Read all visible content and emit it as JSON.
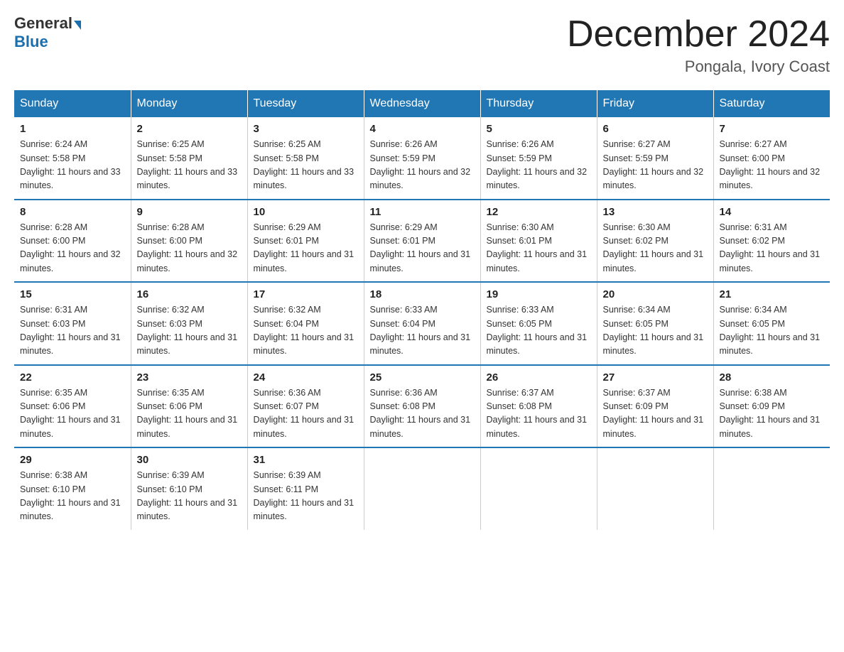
{
  "header": {
    "logo_line1": "General",
    "logo_line2": "Blue",
    "month_title": "December 2024",
    "location": "Pongala, Ivory Coast"
  },
  "weekdays": [
    "Sunday",
    "Monday",
    "Tuesday",
    "Wednesday",
    "Thursday",
    "Friday",
    "Saturday"
  ],
  "weeks": [
    [
      {
        "day": "1",
        "sunrise": "6:24 AM",
        "sunset": "5:58 PM",
        "daylight": "11 hours and 33 minutes."
      },
      {
        "day": "2",
        "sunrise": "6:25 AM",
        "sunset": "5:58 PM",
        "daylight": "11 hours and 33 minutes."
      },
      {
        "day": "3",
        "sunrise": "6:25 AM",
        "sunset": "5:58 PM",
        "daylight": "11 hours and 33 minutes."
      },
      {
        "day": "4",
        "sunrise": "6:26 AM",
        "sunset": "5:59 PM",
        "daylight": "11 hours and 32 minutes."
      },
      {
        "day": "5",
        "sunrise": "6:26 AM",
        "sunset": "5:59 PM",
        "daylight": "11 hours and 32 minutes."
      },
      {
        "day": "6",
        "sunrise": "6:27 AM",
        "sunset": "5:59 PM",
        "daylight": "11 hours and 32 minutes."
      },
      {
        "day": "7",
        "sunrise": "6:27 AM",
        "sunset": "6:00 PM",
        "daylight": "11 hours and 32 minutes."
      }
    ],
    [
      {
        "day": "8",
        "sunrise": "6:28 AM",
        "sunset": "6:00 PM",
        "daylight": "11 hours and 32 minutes."
      },
      {
        "day": "9",
        "sunrise": "6:28 AM",
        "sunset": "6:00 PM",
        "daylight": "11 hours and 32 minutes."
      },
      {
        "day": "10",
        "sunrise": "6:29 AM",
        "sunset": "6:01 PM",
        "daylight": "11 hours and 31 minutes."
      },
      {
        "day": "11",
        "sunrise": "6:29 AM",
        "sunset": "6:01 PM",
        "daylight": "11 hours and 31 minutes."
      },
      {
        "day": "12",
        "sunrise": "6:30 AM",
        "sunset": "6:01 PM",
        "daylight": "11 hours and 31 minutes."
      },
      {
        "day": "13",
        "sunrise": "6:30 AM",
        "sunset": "6:02 PM",
        "daylight": "11 hours and 31 minutes."
      },
      {
        "day": "14",
        "sunrise": "6:31 AM",
        "sunset": "6:02 PM",
        "daylight": "11 hours and 31 minutes."
      }
    ],
    [
      {
        "day": "15",
        "sunrise": "6:31 AM",
        "sunset": "6:03 PM",
        "daylight": "11 hours and 31 minutes."
      },
      {
        "day": "16",
        "sunrise": "6:32 AM",
        "sunset": "6:03 PM",
        "daylight": "11 hours and 31 minutes."
      },
      {
        "day": "17",
        "sunrise": "6:32 AM",
        "sunset": "6:04 PM",
        "daylight": "11 hours and 31 minutes."
      },
      {
        "day": "18",
        "sunrise": "6:33 AM",
        "sunset": "6:04 PM",
        "daylight": "11 hours and 31 minutes."
      },
      {
        "day": "19",
        "sunrise": "6:33 AM",
        "sunset": "6:05 PM",
        "daylight": "11 hours and 31 minutes."
      },
      {
        "day": "20",
        "sunrise": "6:34 AM",
        "sunset": "6:05 PM",
        "daylight": "11 hours and 31 minutes."
      },
      {
        "day": "21",
        "sunrise": "6:34 AM",
        "sunset": "6:05 PM",
        "daylight": "11 hours and 31 minutes."
      }
    ],
    [
      {
        "day": "22",
        "sunrise": "6:35 AM",
        "sunset": "6:06 PM",
        "daylight": "11 hours and 31 minutes."
      },
      {
        "day": "23",
        "sunrise": "6:35 AM",
        "sunset": "6:06 PM",
        "daylight": "11 hours and 31 minutes."
      },
      {
        "day": "24",
        "sunrise": "6:36 AM",
        "sunset": "6:07 PM",
        "daylight": "11 hours and 31 minutes."
      },
      {
        "day": "25",
        "sunrise": "6:36 AM",
        "sunset": "6:08 PM",
        "daylight": "11 hours and 31 minutes."
      },
      {
        "day": "26",
        "sunrise": "6:37 AM",
        "sunset": "6:08 PM",
        "daylight": "11 hours and 31 minutes."
      },
      {
        "day": "27",
        "sunrise": "6:37 AM",
        "sunset": "6:09 PM",
        "daylight": "11 hours and 31 minutes."
      },
      {
        "day": "28",
        "sunrise": "6:38 AM",
        "sunset": "6:09 PM",
        "daylight": "11 hours and 31 minutes."
      }
    ],
    [
      {
        "day": "29",
        "sunrise": "6:38 AM",
        "sunset": "6:10 PM",
        "daylight": "11 hours and 31 minutes."
      },
      {
        "day": "30",
        "sunrise": "6:39 AM",
        "sunset": "6:10 PM",
        "daylight": "11 hours and 31 minutes."
      },
      {
        "day": "31",
        "sunrise": "6:39 AM",
        "sunset": "6:11 PM",
        "daylight": "11 hours and 31 minutes."
      },
      null,
      null,
      null,
      null
    ]
  ]
}
